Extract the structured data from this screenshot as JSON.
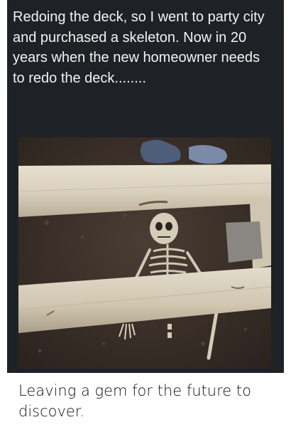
{
  "post": {
    "caption": "Redoing the deck, so I went to party city and purchased a skeleton. Now in 20 years when the new homeowner needs to redo the deck........",
    "image": {
      "subject": "skeleton lying in dirt under deck boards"
    },
    "bottom_text": "Leaving a gem for the future to discover."
  },
  "colors": {
    "card_background": "#1e2227",
    "caption_text": "#f2f2f2",
    "page_background": "#ffffff",
    "bottom_text": "#111111"
  }
}
